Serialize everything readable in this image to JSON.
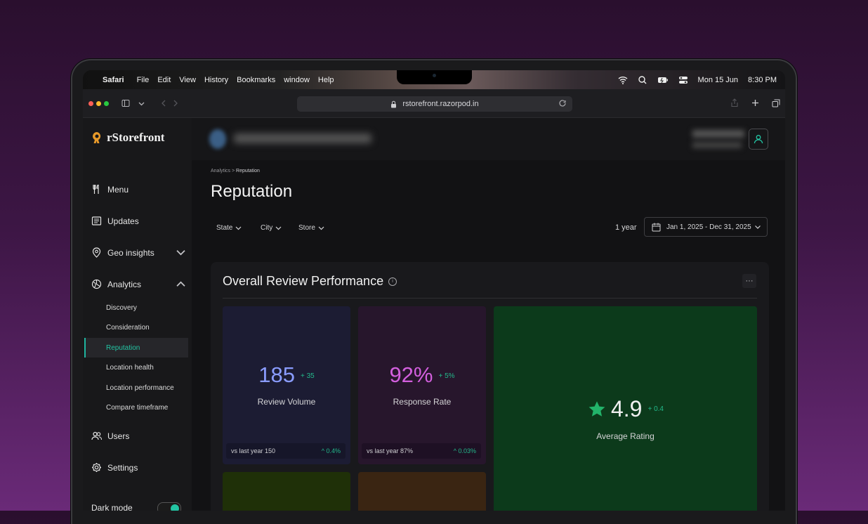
{
  "menubar": {
    "app_name": "Safari",
    "menus": [
      "File",
      "Edit",
      "View",
      "History",
      "Bookmarks",
      "window",
      "Help"
    ],
    "date": "Mon 15 Jun",
    "time": "8:30 PM"
  },
  "browser": {
    "url": "rstorefront.razorpod.in"
  },
  "brand": {
    "name": "rStorefront",
    "accent": "#e89a2a"
  },
  "sidebar": {
    "items": [
      {
        "label": "Menu"
      },
      {
        "label": "Updates"
      },
      {
        "label": "Geo insights"
      },
      {
        "label": "Analytics"
      },
      {
        "label": "Users"
      },
      {
        "label": "Settings"
      }
    ],
    "analytics_sub": [
      "Discovery",
      "Consideration",
      "Reputation",
      "Location health",
      "Location performance",
      "Compare timeframe"
    ],
    "active_sub": "Reputation",
    "dark_mode_label": "Dark mode",
    "dark_mode_on": true
  },
  "page": {
    "breadcrumb_parent": "Analytics",
    "breadcrumb_current": "Reputation",
    "title": "Reputation",
    "filters": [
      "State",
      "City",
      "Store"
    ],
    "range_label": "1 year",
    "date_range": "Jan 1, 2025 - Dec 31, 2025"
  },
  "card": {
    "title": "Overall Review Performance",
    "metrics": [
      {
        "value": "185",
        "delta": "+ 35",
        "label": "Review Volume",
        "prev_label": "vs last year",
        "prev_value": "150",
        "change": "0.4%"
      },
      {
        "value": "92%",
        "delta": "+ 5%",
        "label": "Response Rate",
        "prev_label": "vs last year",
        "prev_value": "87%",
        "change": "0.03%"
      },
      {
        "value": "4.9",
        "delta": "+ 0.4",
        "label": "Average Rating"
      }
    ]
  },
  "colors": {
    "accent_teal": "#1fb5a0",
    "positive": "#23b98b",
    "review_volume": "#8a9cff",
    "response_rate": "#d35fde",
    "star": "#22b36a"
  }
}
